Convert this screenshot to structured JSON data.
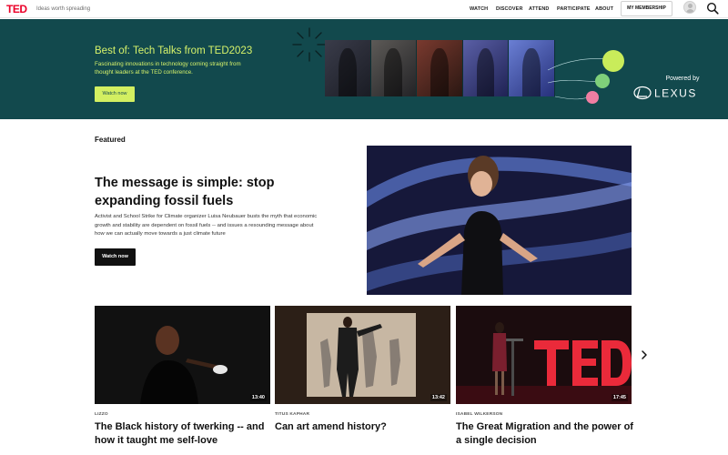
{
  "header": {
    "logo": "TED",
    "tagline": "Ideas worth spreading",
    "nav": [
      "WATCH",
      "DISCOVER",
      "ATTEND",
      "PARTICIPATE",
      "ABOUT"
    ],
    "membership_label": "MY MEMBERSHIP",
    "icons": {
      "avatar": "user-avatar-icon",
      "search": "search-icon"
    }
  },
  "banner": {
    "title": "Best of: Tech Talks from TED2023",
    "description": "Fascinating innovations in technology coming straight from thought leaders at the TED conference.",
    "button_label": "Watch now",
    "sponsor_label": "Powered by",
    "sponsor_logo_text": "LEXUS"
  },
  "featured": {
    "section_label": "Featured",
    "title": "The message is simple: stop expanding fossil fuels",
    "description": "Activist and School Strike for Climate organizer Luisa Neubauer busts the myth that economic growth and stability are dependent on fossil fuels -- and issues a resounding message about how we can actually move towards a just climate future",
    "button_label": "Watch now"
  },
  "cards": [
    {
      "speaker": "LIZZO",
      "title": "The Black history of twerking -- and how it taught me self-love",
      "duration": "13:40"
    },
    {
      "speaker": "TITUS KAPHAR",
      "title": "Can art amend history?",
      "duration": "13:42"
    },
    {
      "speaker": "ISABEL WILKERSON",
      "title": "The Great Migration and the power of a single decision",
      "duration": "17:45"
    }
  ],
  "colors": {
    "brand_red": "#eb0028",
    "banner_bg": "#12494d",
    "banner_accent": "#d3ef61",
    "button_dark": "#111111"
  },
  "icons": {
    "next": "chevron-right-icon",
    "burst": "sparkle-burst-icon"
  }
}
